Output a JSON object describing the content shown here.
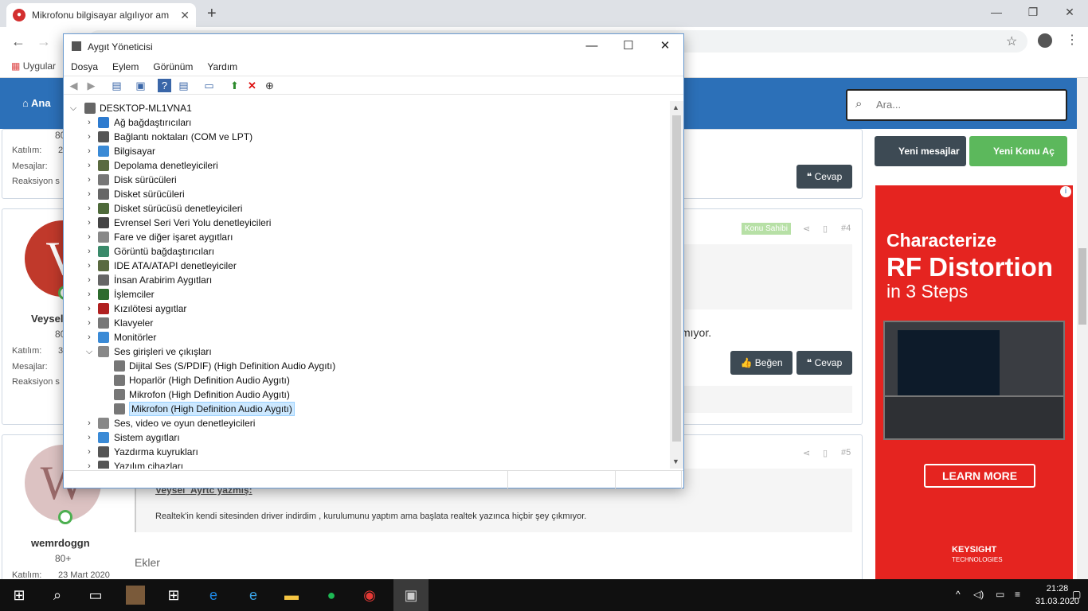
{
  "browser": {
    "tab_title": "Mikrofonu bilgisayar algılıyor am",
    "apps_label": "Uygular"
  },
  "forum": {
    "home_label": "Ana",
    "search_placeholder": "Ara...",
    "new_messages": "Yeni mesajlar",
    "new_topic": "Yeni Konu Aç",
    "reply": "Cevap",
    "like": "Beğen",
    "owner_badge": "Konu Sahibi",
    "post4_number": "#4",
    "post5_number": "#5",
    "post_top": {
      "count": "80",
      "stats": [
        "Katılım:",
        "Mesajlar:",
        "Reaksiyon s"
      ],
      "stat_values": [
        "2",
        "",
        ""
      ]
    },
    "post4": {
      "avatar_letter": "V",
      "username": "Veysel",
      "count": "80",
      "stats": [
        "Katılım:",
        "Mesajlar:",
        "Reaksiyon s"
      ],
      "stat_values": [
        "3",
        "",
        ""
      ],
      "text_tail": "mıyor."
    },
    "post5": {
      "avatar_letter": "W",
      "username": "wemrdoggn",
      "count": "80+",
      "join_label": "Katılım:",
      "join_date": "23 Mart 2020",
      "quote_author": "Veysel_Ayrtc yazmış:",
      "text": "Realtek'in kendi sitesinden driver indirdim , kurulumunu yaptım ama başlata realtek yazınca hiçbir şey çıkmıyor.",
      "attachments": "Ekler"
    },
    "ad": {
      "line1": "Characterize",
      "line2": "RF Distortion",
      "line3": "in 3 Steps",
      "cta": "LEARN MORE",
      "brand": "KEYSIGHT",
      "brand_sub": "TECHNOLOGIES"
    }
  },
  "device_manager": {
    "title": "Aygıt Yöneticisi",
    "menu": [
      "Dosya",
      "Eylem",
      "Görünüm",
      "Yardım"
    ],
    "root": "DESKTOP-ML1VNA1",
    "categories": [
      {
        "label": "Ağ bağdaştırıcıları",
        "color": "#2e7bcf"
      },
      {
        "label": "Bağlantı noktaları (COM ve LPT)",
        "color": "#555555"
      },
      {
        "label": "Bilgisayar",
        "color": "#3a8ad6"
      },
      {
        "label": "Depolama denetleyicileri",
        "color": "#5a6a40"
      },
      {
        "label": "Disk sürücüleri",
        "color": "#777777"
      },
      {
        "label": "Disket sürücüleri",
        "color": "#666666"
      },
      {
        "label": "Disket sürücüsü denetleyicileri",
        "color": "#4e6a3a"
      },
      {
        "label": "Evrensel Seri Veri Yolu denetleyicileri",
        "color": "#444444"
      },
      {
        "label": "Fare ve diğer işaret aygıtları",
        "color": "#888888"
      },
      {
        "label": "Görüntü bağdaştırıcıları",
        "color": "#3a8a6a"
      },
      {
        "label": "IDE ATA/ATAPI denetleyiciler",
        "color": "#5a6a40"
      },
      {
        "label": "İnsan Arabirim Aygıtları",
        "color": "#666666"
      },
      {
        "label": "İşlemciler",
        "color": "#2d6b2d"
      },
      {
        "label": "Kızılötesi aygıtlar",
        "color": "#b02020"
      },
      {
        "label": "Klavyeler",
        "color": "#777777"
      },
      {
        "label": "Monitörler",
        "color": "#3a8ad6"
      },
      {
        "label": "Ses girişleri ve çıkışları",
        "color": "#888888"
      }
    ],
    "audio_children": [
      "Dijital Ses (S/PDIF) (High Definition Audio Aygıtı)",
      "Hoparlör (High Definition Audio Aygıtı)",
      "Mikrofon (High Definition Audio Aygıtı)",
      "Mikrofon (High Definition Audio Aygıtı)"
    ],
    "after": [
      {
        "label": "Ses, video ve oyun denetleyicileri",
        "color": "#888888"
      },
      {
        "label": "Sistem aygıtları",
        "color": "#3a8ad6"
      },
      {
        "label": "Yazdırma kuyrukları",
        "color": "#555555"
      },
      {
        "label": "Yazılım cihazları",
        "color": "#555555"
      }
    ]
  },
  "taskbar": {
    "time": "21:28",
    "date": "31.03.2020"
  }
}
